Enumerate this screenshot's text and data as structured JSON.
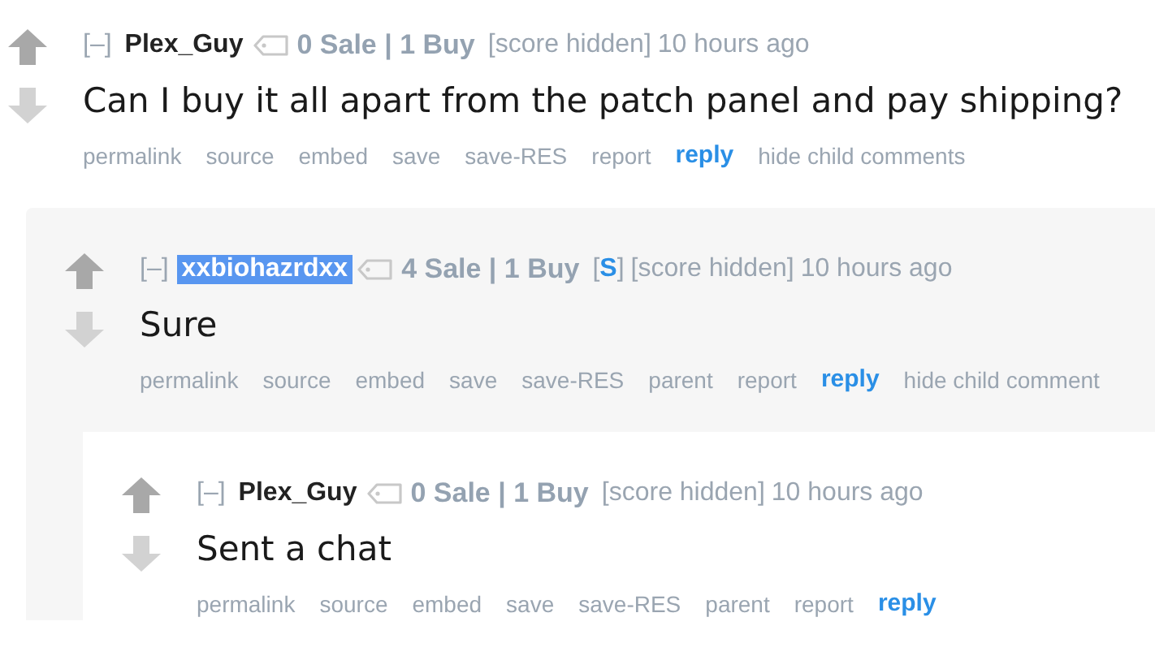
{
  "comments": [
    {
      "collapse": "[–]",
      "author": "Plex_Guy",
      "author_highlighted": false,
      "flair": "0 Sale | 1 Buy",
      "score": "[score hidden]",
      "time": "10 hours ago",
      "body": "Can I buy it all apart from the patch panel and pay shipping?",
      "actions": [
        {
          "label": "permalink",
          "kind": "link"
        },
        {
          "label": "source",
          "kind": "link"
        },
        {
          "label": "embed",
          "kind": "link"
        },
        {
          "label": "save",
          "kind": "link"
        },
        {
          "label": "save-RES",
          "kind": "link"
        },
        {
          "label": "report",
          "kind": "link"
        },
        {
          "label": "reply",
          "kind": "reply"
        },
        {
          "label": "hide child comments",
          "kind": "link"
        }
      ],
      "children": [
        {
          "collapse": "[–]",
          "author": "xxbiohazrdxx",
          "author_highlighted": true,
          "flair": "4 Sale | 1 Buy",
          "submitter": {
            "open": "[",
            "tag": "S",
            "close": "]"
          },
          "score": "[score hidden]",
          "time": "10 hours ago",
          "body": "Sure",
          "actions": [
            {
              "label": "permalink",
              "kind": "link"
            },
            {
              "label": "source",
              "kind": "link"
            },
            {
              "label": "embed",
              "kind": "link"
            },
            {
              "label": "save",
              "kind": "link"
            },
            {
              "label": "save-RES",
              "kind": "link"
            },
            {
              "label": "parent",
              "kind": "link"
            },
            {
              "label": "report",
              "kind": "link"
            },
            {
              "label": "reply",
              "kind": "reply"
            },
            {
              "label": "hide child comment",
              "kind": "link"
            }
          ],
          "children": [
            {
              "collapse": "[–]",
              "author": "Plex_Guy",
              "author_highlighted": false,
              "flair": "0 Sale | 1 Buy",
              "score": "[score hidden]",
              "time": "10 hours ago",
              "body": "Sent a chat",
              "actions": [
                {
                  "label": "permalink",
                  "kind": "link"
                },
                {
                  "label": "source",
                  "kind": "link"
                },
                {
                  "label": "embed",
                  "kind": "link"
                },
                {
                  "label": "save",
                  "kind": "link"
                },
                {
                  "label": "save-RES",
                  "kind": "link"
                },
                {
                  "label": "parent",
                  "kind": "link"
                },
                {
                  "label": "report",
                  "kind": "link"
                },
                {
                  "label": "reply",
                  "kind": "reply"
                }
              ]
            }
          ]
        }
      ]
    }
  ]
}
